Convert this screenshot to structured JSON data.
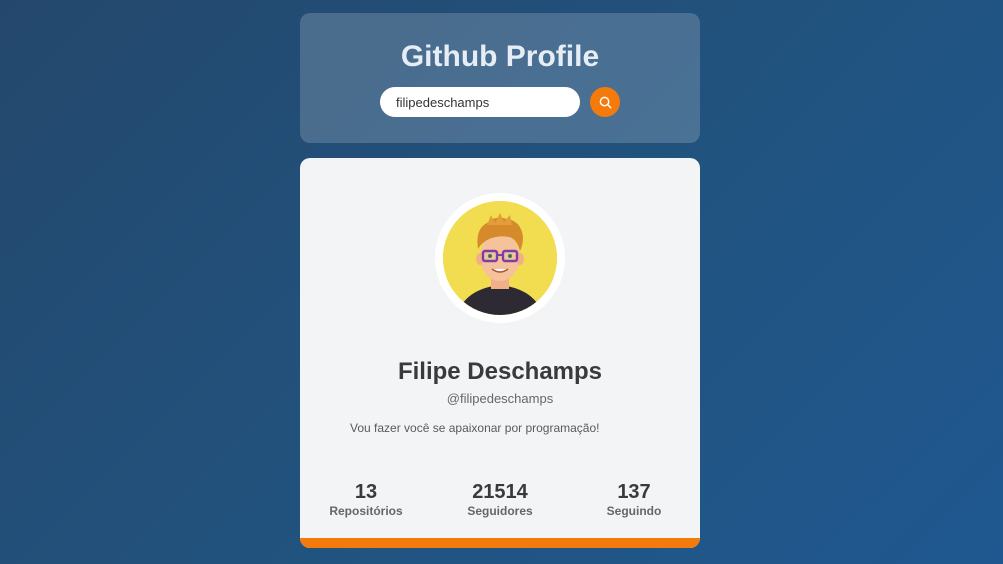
{
  "header": {
    "title": "Github Profile",
    "search": {
      "value": "filipedeschamps",
      "placeholder": ""
    },
    "search_icon": "search-icon"
  },
  "profile": {
    "avatar_icon": "avatar",
    "name": "Filipe Deschamps",
    "login": "@filipedeschamps",
    "bio": "Vou fazer você se apaixonar por programação!",
    "stats": [
      {
        "value": "13",
        "label": "Repositórios"
      },
      {
        "value": "21514",
        "label": "Seguidores"
      },
      {
        "value": "137",
        "label": "Seguindo"
      }
    ]
  },
  "colors": {
    "accent": "#f57a0c",
    "card_bg": "#f3f4f6",
    "avatar_bg": "#f1dd4f"
  }
}
